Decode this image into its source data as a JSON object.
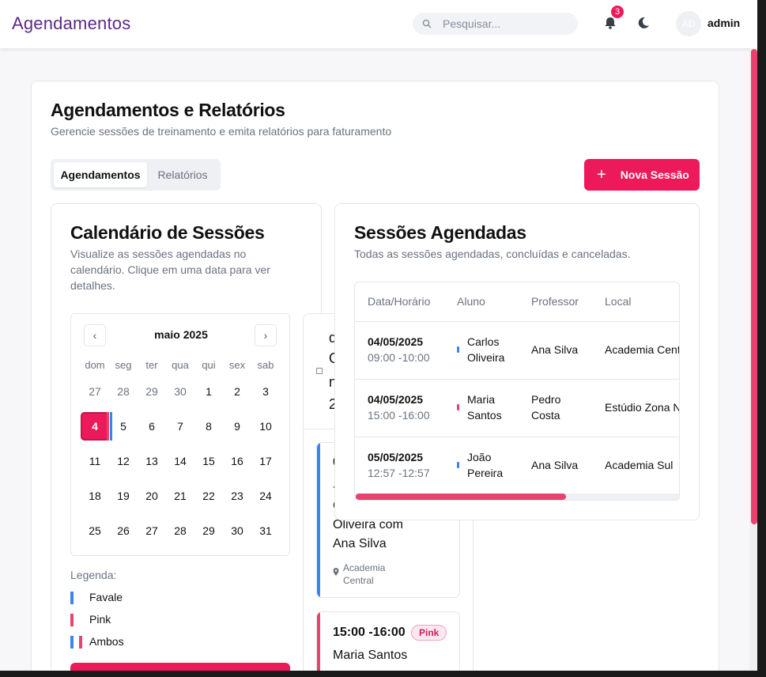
{
  "header": {
    "brand": "Agendamentos",
    "search_placeholder": "Pesquisar...",
    "notifications_count": "3",
    "avatar_initials": "AD",
    "username": "admin"
  },
  "page": {
    "title": "Agendamentos e Relatórios",
    "subtitle": "Gerencie sessões de treinamento e emita relatórios para faturamento",
    "tabs": [
      "Agendamentos",
      "Relatórios"
    ],
    "active_tab": "Agendamentos",
    "new_session_label": "Nova Sessão"
  },
  "calendar": {
    "title": "Calendário de Sessões",
    "description": "Visualize as sessões agendadas no calendário. Clique em uma data para ver detalhes.",
    "month_label": "maio 2025",
    "weekdays": [
      "dom",
      "seg",
      "ter",
      "qua",
      "qui",
      "sex",
      "sab"
    ],
    "weeks": [
      [
        "27",
        "28",
        "29",
        "30",
        "1",
        "2",
        "3"
      ],
      [
        "4",
        "5",
        "6",
        "7",
        "8",
        "9",
        "10"
      ],
      [
        "11",
        "12",
        "13",
        "14",
        "15",
        "16",
        "17"
      ],
      [
        "18",
        "19",
        "20",
        "21",
        "22",
        "23",
        "24"
      ],
      [
        "25",
        "26",
        "27",
        "28",
        "29",
        "30",
        "31"
      ]
    ],
    "selected_day": "4",
    "legend_title": "Legenda:",
    "legend": [
      {
        "label": "Favale",
        "color": "#3b82f6"
      },
      {
        "label": "Pink",
        "color": "#e8436f"
      },
      {
        "label": "Ambos",
        "color": "both"
      }
    ]
  },
  "day_detail": {
    "header_lines": [
      "d",
      "O",
      "n",
      "2"
    ],
    "events": [
      {
        "time": "0",
        "badge": "",
        "lines": [
          "-",
          "C",
          "Oliveira com",
          "Ana Silva"
        ],
        "location": "Academia Central",
        "color": "#3b82f6"
      },
      {
        "time": "15:00 -16:00",
        "badge": "Pink",
        "lines": [
          "Maria Santos"
        ],
        "location": "",
        "color": "#e8436f"
      }
    ]
  },
  "sessions": {
    "title": "Sessões Agendadas",
    "subtitle": "Todas as sessões agendadas, concluídas e canceladas.",
    "columns": [
      "Data/Horário",
      "Aluno",
      "Professor",
      "Local"
    ],
    "rows": [
      {
        "date": "04/05/2025",
        "time": "09:00 -10:00",
        "student": [
          "Carlos",
          "Oliveira"
        ],
        "teacher": [
          "Ana Silva"
        ],
        "location": "Academia Cent",
        "color": "#3b82f6"
      },
      {
        "date": "04/05/2025",
        "time": "15:00 -16:00",
        "student": [
          "Maria",
          "Santos"
        ],
        "teacher": [
          "Pedro",
          "Costa"
        ],
        "location": "Estúdio Zona N",
        "color": "#e8436f"
      },
      {
        "date": "05/05/2025",
        "time": "12:57 -12:57",
        "student": [
          "João",
          "Pereira"
        ],
        "teacher": [
          "Ana Silva"
        ],
        "location": "Academia Sul",
        "color": "#3b82f6"
      }
    ]
  },
  "colors": {
    "accent": "#ec1a5a",
    "brand": "#5b2a86",
    "blue": "#3b82f6",
    "pink": "#e8436f"
  }
}
